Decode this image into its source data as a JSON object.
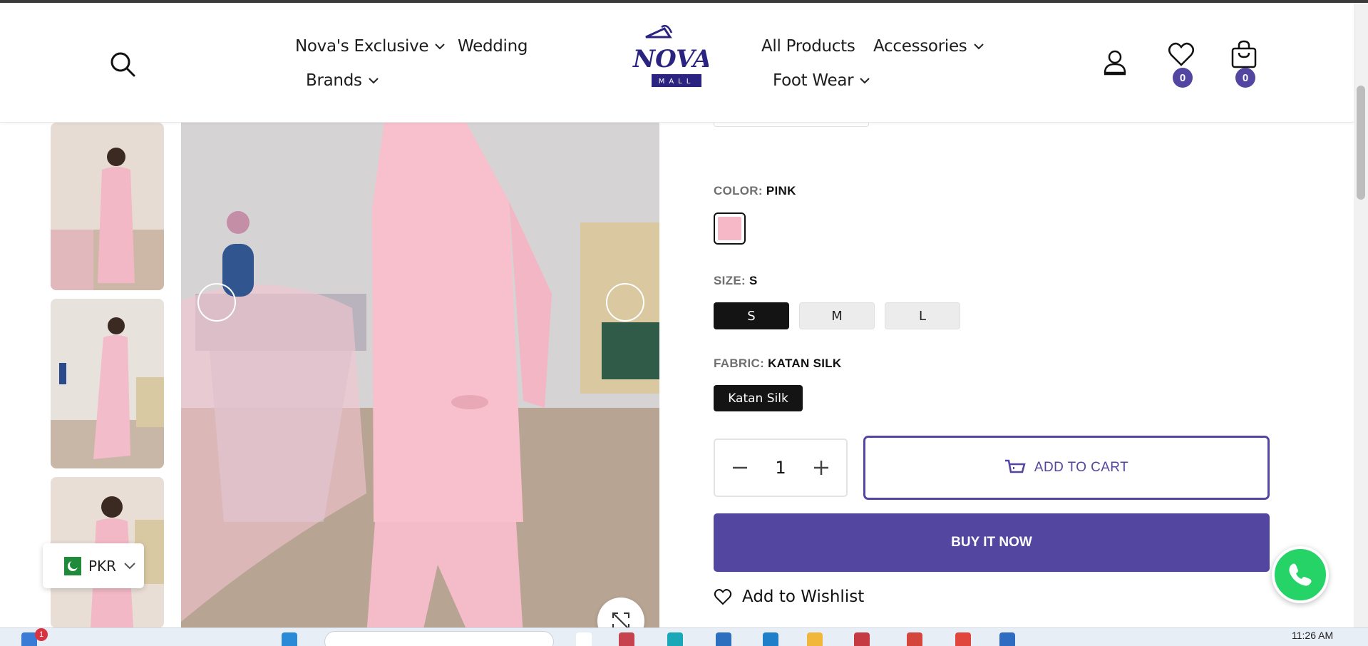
{
  "header": {
    "nav_left": [
      {
        "label": "Nova's Exclusive",
        "dropdown": true
      },
      {
        "label": "Wedding",
        "dropdown": false
      },
      {
        "label": "Brands",
        "dropdown": true
      }
    ],
    "nav_right": [
      {
        "label": "All Products",
        "dropdown": false
      },
      {
        "label": "Accessories",
        "dropdown": true
      },
      {
        "label": "Foot Wear",
        "dropdown": true
      }
    ],
    "logo_text": "NOVA",
    "logo_subtext": "MALL",
    "wishlist_count": "0",
    "cart_count": "0"
  },
  "product": {
    "color_label": "COLOR:",
    "color_value": "PINK",
    "swatch_color": "#f6b7c7",
    "size_label": "SIZE:",
    "size_value": "S",
    "sizes": [
      "S",
      "M",
      "L"
    ],
    "selected_size": "S",
    "fabric_label": "FABRIC:",
    "fabric_value": "KATAN SILK",
    "fabric_option": "Katan Silk",
    "quantity": "1",
    "add_to_cart": "ADD TO CART",
    "buy_now": "BUY IT NOW",
    "wishlist": "Add to Wishlist"
  },
  "currency": {
    "code": "PKR"
  },
  "taskbar": {
    "time": "11:26 AM",
    "notification_count": "1"
  },
  "colors": {
    "accent": "#5246a0",
    "dark": "#141414",
    "whatsapp": "#25d366"
  }
}
